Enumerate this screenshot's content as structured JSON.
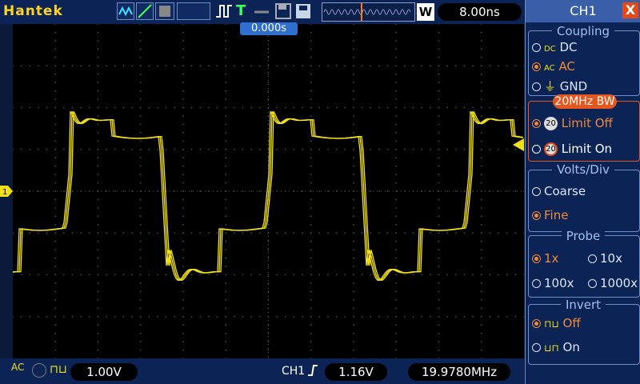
{
  "brand": "Hantek",
  "top": {
    "timebase": "8.00ns",
    "w_label": "W",
    "trigger_pos": "0.000s",
    "t_label": "T"
  },
  "bottom": {
    "coupling_icon": "AC",
    "volts_div": "1.00V",
    "trig_source": "CH1",
    "trig_level": "1.16V",
    "frequency": "19.9780MHz"
  },
  "channel_marker": "1",
  "panel": {
    "title": "CH1",
    "close": "X",
    "coupling": {
      "title": "Coupling",
      "options": [
        "DC",
        "AC",
        "GND"
      ],
      "selected": "AC"
    },
    "bw": {
      "title": "20MHz BW",
      "options": [
        "Limit Off",
        "Limit On"
      ],
      "selected": "Limit Off",
      "badge_text": "20"
    },
    "volts": {
      "title": "Volts/Div",
      "options": [
        "Coarse",
        "Fine"
      ],
      "selected": "Fine"
    },
    "probe": {
      "title": "Probe",
      "options": [
        "1x",
        "10x",
        "100x",
        "1000x"
      ],
      "selected": "1x"
    },
    "invert": {
      "title": "Invert",
      "options": [
        "Off",
        "On"
      ],
      "selected": "Off"
    }
  },
  "colors": {
    "trace": "#f2e01a",
    "grid": "#5a5a5a",
    "accent": "#e4571e",
    "selected": "#f08a3a"
  },
  "icons": [
    "wave-mode-icon",
    "line-icon",
    "persist-icon",
    "pulse-icon",
    "trigger-t-icon",
    "save-icon",
    "disk-icon"
  ]
}
